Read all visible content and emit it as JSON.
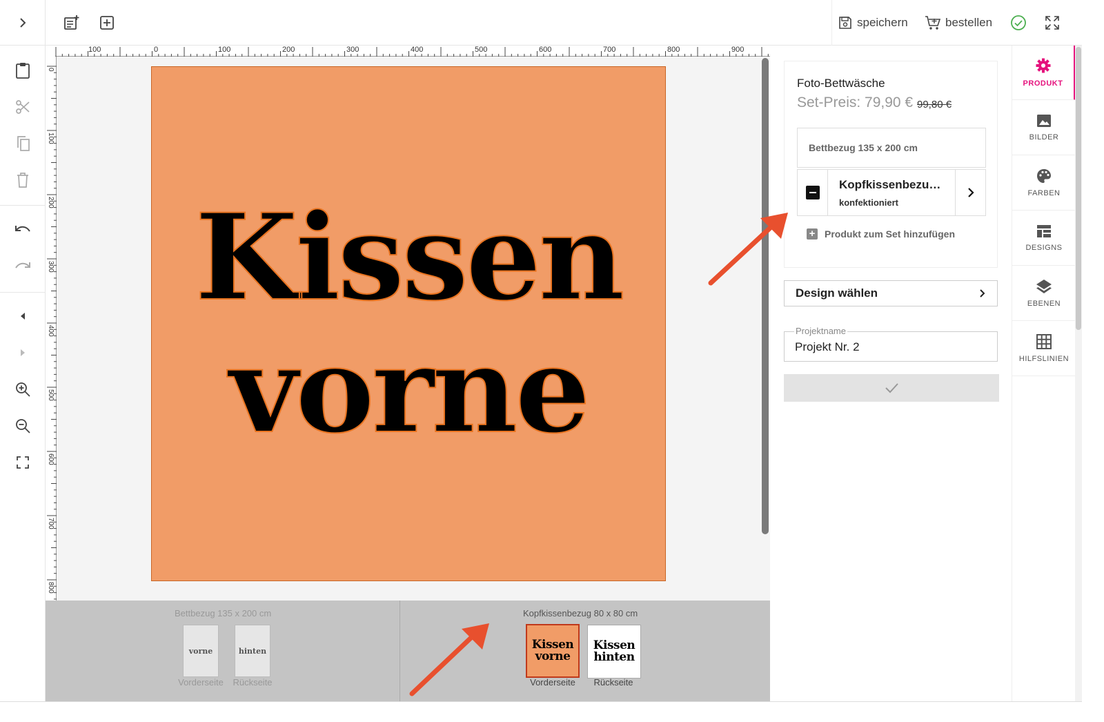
{
  "toolbar": {
    "save_label": "speichern",
    "order_label": "bestellen",
    "icons": [
      "chevron-right-icon",
      "add-text-icon",
      "add-element-icon",
      "save-icon",
      "cart-icon",
      "check-circle-icon",
      "fullscreen-icon"
    ]
  },
  "rulers": {
    "horizontal": [
      "100",
      "0",
      "100",
      "200",
      "300",
      "400",
      "500",
      "600",
      "700",
      "800",
      "900"
    ],
    "vertical": [
      "0",
      "100",
      "200",
      "300",
      "400",
      "500",
      "600",
      "700",
      "800"
    ]
  },
  "canvas": {
    "line1": "Kissen",
    "line2": "vorne",
    "fill_color": "#f19c67",
    "outline_color": "#e8731f"
  },
  "pages": {
    "group1": {
      "title": "Bettbezug 135 x 200 cm",
      "front_thumb": "vorne",
      "back_thumb": "hinten",
      "front_label": "Vorderseite",
      "back_label": "Rückseite"
    },
    "group2": {
      "title": "Kopfkissenbezug 80 x 80 cm",
      "front_line1": "Kissen",
      "front_line2": "vorne",
      "back_line1": "Kissen",
      "back_line2": "hinten",
      "front_label": "Vorderseite",
      "back_label": "Rückseite"
    }
  },
  "product": {
    "title": "Foto-Bettwäsche",
    "price": "Set-Preis: 79,90 €",
    "old_price": "99,80 €",
    "item1": "Bettbezug 135 x 200 cm",
    "item2_name": "Kopfkissenbezu…",
    "item2_sub": "konfektioniert",
    "add_label": "Produkt zum Set hinzufügen",
    "design_label": "Design wählen",
    "project_label": "Projektname",
    "project_value": "Projekt Nr. 2"
  },
  "tabs": [
    "PRODUKT",
    "BILDER",
    "FARBEN",
    "DESIGNS",
    "EBENEN",
    "HILFSLINIEN"
  ],
  "colors": {
    "accent": "#e5127d",
    "arrow": "#e8502e",
    "check": "#4caf50"
  }
}
